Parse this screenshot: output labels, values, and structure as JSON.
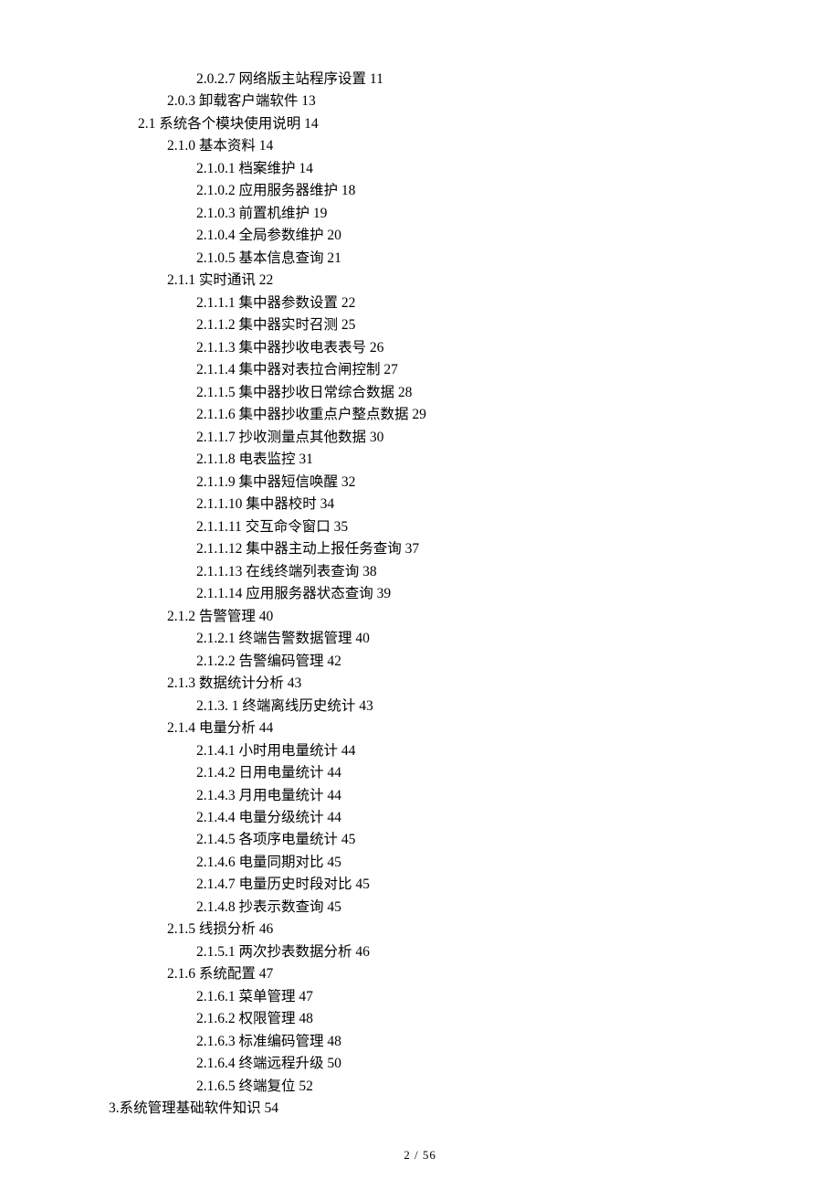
{
  "footer": {
    "page": "2",
    "sep": " / ",
    "total": "56"
  },
  "toc": [
    {
      "indent": 3,
      "num": "2.0.2.7",
      "title": "网络版主站程序设置",
      "page": "11",
      "wide": true
    },
    {
      "indent": 2,
      "num": "2.0.3",
      "title": "卸载客户端软件",
      "page": "13"
    },
    {
      "indent": 1,
      "num": "2.1",
      "title": "系统各个模块使用说明",
      "page": "14"
    },
    {
      "indent": 2,
      "num": "2.1.0",
      "title": "基本资料",
      "page": "14"
    },
    {
      "indent": 3,
      "num": "2.1.0.1",
      "title": "档案维护",
      "page": "14"
    },
    {
      "indent": 3,
      "num": "2.1.0.2",
      "title": "应用服务器维护",
      "page": "18"
    },
    {
      "indent": 3,
      "num": "2.1.0.3",
      "title": "前置机维护",
      "page": "19"
    },
    {
      "indent": 3,
      "num": "2.1.0.4",
      "title": "全局参数维护",
      "page": "20"
    },
    {
      "indent": 3,
      "num": "2.1.0.5",
      "title": "基本信息查询",
      "page": "21"
    },
    {
      "indent": 2,
      "num": "2.1.1",
      "title": "实时通讯",
      "page": "22"
    },
    {
      "indent": 3,
      "num": "2.1.1.1",
      "title": "集中器参数设置",
      "page": "22"
    },
    {
      "indent": 3,
      "num": "2.1.1.2",
      "title": "集中器实时召测",
      "page": "25"
    },
    {
      "indent": 3,
      "num": "2.1.1.3",
      "title": "集中器抄收电表表号",
      "page": "26"
    },
    {
      "indent": 3,
      "num": "2.1.1.4",
      "title": "集中器对表拉合闸控制",
      "page": "27"
    },
    {
      "indent": 3,
      "num": "2.1.1.5",
      "title": "集中器抄收日常综合数据",
      "page": "28"
    },
    {
      "indent": 3,
      "num": "2.1.1.6",
      "title": "集中器抄收重点户整点数据",
      "page": "29"
    },
    {
      "indent": 3,
      "num": "2.1.1.7",
      "title": "抄收测量点其他数据",
      "page": "30"
    },
    {
      "indent": 3,
      "num": "2.1.1.8",
      "title": "电表监控",
      "page": "31"
    },
    {
      "indent": 3,
      "num": "2.1.1.9",
      "title": "集中器短信唤醒",
      "page": "32"
    },
    {
      "indent": 3,
      "num": "2.1.1.10",
      "title": "集中器校时",
      "page": "34"
    },
    {
      "indent": 3,
      "num": "2.1.1.11",
      "title": "交互命令窗口",
      "page": "35"
    },
    {
      "indent": 3,
      "num": "2.1.1.12",
      "title": "集中器主动上报任务查询",
      "page": "37",
      "wide": true
    },
    {
      "indent": 3,
      "num": "2.1.1.13",
      "title": "在线终端列表查询",
      "page": "38"
    },
    {
      "indent": 3,
      "num": "2.1.1.14",
      "title": "应用服务器状态查询",
      "page": "39"
    },
    {
      "indent": 2,
      "num": "2.1.2",
      "title": "告警管理",
      "page": "40"
    },
    {
      "indent": 3,
      "num": "2.1.2.1",
      "title": "终端告警数据管理",
      "page": "40"
    },
    {
      "indent": 3,
      "num": "2.1.2.2",
      "title": "告警编码管理",
      "page": "42"
    },
    {
      "indent": 2,
      "num": "2.1.3",
      "title": "数据统计分析",
      "page": "43"
    },
    {
      "indent": 3,
      "num": "2.1.3. 1",
      "title": "终端离线历史统计",
      "page": "43"
    },
    {
      "indent": 2,
      "num": "2.1.4",
      "title": "电量分析",
      "page": "44"
    },
    {
      "indent": 3,
      "num": "2.1.4.1",
      "title": "小时用电量统计",
      "page": "44"
    },
    {
      "indent": 3,
      "num": "2.1.4.2",
      "title": "日用电量统计",
      "page": "44"
    },
    {
      "indent": 3,
      "num": "2.1.4.3",
      "title": "月用电量统计",
      "page": "44"
    },
    {
      "indent": 3,
      "num": "2.1.4.4",
      "title": "电量分级统计",
      "page": "44"
    },
    {
      "indent": 3,
      "num": "2.1.4.5",
      "title": "各项序电量统计",
      "page": "45"
    },
    {
      "indent": 3,
      "num": "2.1.4.6",
      "title": "电量同期对比",
      "page": "45"
    },
    {
      "indent": 3,
      "num": "2.1.4.7",
      "title": "电量历史时段对比",
      "page": "45"
    },
    {
      "indent": 3,
      "num": "2.1.4.8",
      "title": "抄表示数查询",
      "page": "45"
    },
    {
      "indent": 2,
      "num": "2.1.5",
      "title": "线损分析",
      "page": "46"
    },
    {
      "indent": 3,
      "num": "2.1.5.1",
      "title": "两次抄表数据分析",
      "page": "46"
    },
    {
      "indent": 2,
      "num": "2.1.6",
      "title": "系统配置",
      "page": "47"
    },
    {
      "indent": 3,
      "num": "2.1.6.1",
      "title": "菜单管理",
      "page": "47"
    },
    {
      "indent": 3,
      "num": "2.1.6.2",
      "title": "权限管理",
      "page": "48"
    },
    {
      "indent": 3,
      "num": "2.1.6.3",
      "title": "标准编码管理",
      "page": "48",
      "wide": true
    },
    {
      "indent": 3,
      "num": "2.1.6.4",
      "title": "终端远程升级",
      "page": "50"
    },
    {
      "indent": 3,
      "num": "2.1.6.5",
      "title": "终端复位",
      "page": "52"
    },
    {
      "indent": 0,
      "num": "3.",
      "title": "系统管理基础软件知识",
      "page": "54",
      "tight": true
    }
  ]
}
